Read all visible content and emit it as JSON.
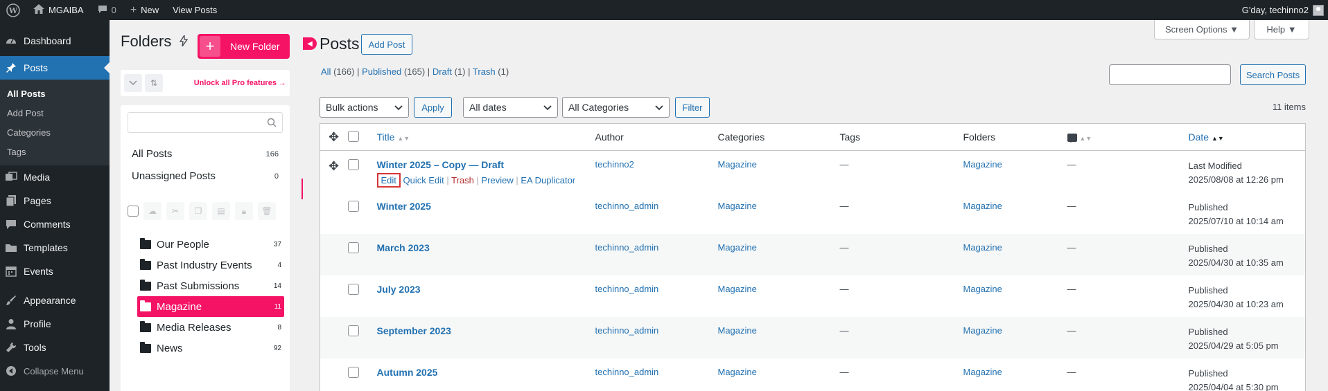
{
  "admin_bar": {
    "site_name": "MGAIBA",
    "comments_count": "0",
    "new_label": "New",
    "view_posts_label": "View Posts",
    "greeting": "G'day, techinno2"
  },
  "menu": {
    "items": [
      {
        "label": "Dashboard",
        "icon": "dashboard-icon"
      },
      {
        "label": "Posts",
        "icon": "pin-icon"
      },
      {
        "label": "Media",
        "icon": "media-icon"
      },
      {
        "label": "Pages",
        "icon": "pages-icon"
      },
      {
        "label": "Comments",
        "icon": "comments-icon"
      },
      {
        "label": "Templates",
        "icon": "templates-icon"
      },
      {
        "label": "Events",
        "icon": "calendar-icon"
      },
      {
        "label": "Appearance",
        "icon": "brush-icon"
      },
      {
        "label": "Profile",
        "icon": "user-icon"
      },
      {
        "label": "Tools",
        "icon": "wrench-icon"
      }
    ],
    "posts_submenu": [
      "All Posts",
      "Add Post",
      "Categories",
      "Tags"
    ],
    "collapse_label": "Collapse Menu"
  },
  "folders": {
    "title": "Folders",
    "new_folder_label": "New Folder",
    "unlock_label": "Unlock all Pro features →",
    "all_posts_label": "All Posts",
    "all_posts_count": "166",
    "unassigned_label": "Unassigned Posts",
    "unassigned_count": "0",
    "tree": [
      {
        "name": "Our People",
        "count": "37"
      },
      {
        "name": "Past Industry Events",
        "count": "4"
      },
      {
        "name": "Past Submissions",
        "count": "14"
      },
      {
        "name": "Magazine",
        "count": "11"
      },
      {
        "name": "Media Releases",
        "count": "8"
      },
      {
        "name": "News",
        "count": "92"
      }
    ]
  },
  "page": {
    "title": "Posts",
    "add_post_label": "Add Post",
    "screen_options_label": "Screen Options ▼",
    "help_label": "Help ▼",
    "filters": {
      "all": "All",
      "all_count": "(166)",
      "published": "Published",
      "published_count": "(165)",
      "draft": "Draft",
      "draft_count": "(1)",
      "trash": "Trash",
      "trash_count": "(1)"
    },
    "search_button_label": "Search Posts",
    "bulk_actions": "Bulk actions",
    "apply_label": "Apply",
    "all_dates": "All dates",
    "all_categories": "All Categories",
    "filter_label": "Filter",
    "items_count": "11 items"
  },
  "table": {
    "columns": {
      "title": "Title",
      "author": "Author",
      "categories": "Categories",
      "tags": "Tags",
      "folders": "Folders",
      "date": "Date"
    },
    "row_actions": {
      "edit": "Edit",
      "quick_edit": "Quick Edit",
      "trash": "Trash",
      "preview": "Preview",
      "duplicator": "EA Duplicator"
    },
    "rows": [
      {
        "title": "Winter 2025 – Copy — Draft",
        "author": "techinno2",
        "category": "Magazine",
        "tags": "—",
        "folder": "Magazine",
        "comments": "—",
        "status": "Last Modified",
        "date": "2025/08/08 at 12:26 pm"
      },
      {
        "title": "Winter 2025",
        "author": "techinno_admin",
        "category": "Magazine",
        "tags": "—",
        "folder": "Magazine",
        "comments": "—",
        "status": "Published",
        "date": "2025/07/10 at 10:14 am"
      },
      {
        "title": "March 2023",
        "author": "techinno_admin",
        "category": "Magazine",
        "tags": "—",
        "folder": "Magazine",
        "comments": "—",
        "status": "Published",
        "date": "2025/04/30 at 10:35 am"
      },
      {
        "title": "July 2023",
        "author": "techinno_admin",
        "category": "Magazine",
        "tags": "—",
        "folder": "Magazine",
        "comments": "—",
        "status": "Published",
        "date": "2025/04/30 at 10:23 am"
      },
      {
        "title": "September 2023",
        "author": "techinno_admin",
        "category": "Magazine",
        "tags": "—",
        "folder": "Magazine",
        "comments": "—",
        "status": "Published",
        "date": "2025/04/29 at 5:05 pm"
      },
      {
        "title": "Autumn 2025",
        "author": "techinno_admin",
        "category": "Magazine",
        "tags": "—",
        "folder": "Magazine",
        "comments": "—",
        "status": "Published",
        "date": "2025/04/04 at 5:30 pm"
      }
    ]
  },
  "colors": {
    "accent": "#2271b1",
    "folders_brand": "#f51366",
    "admin_dark": "#1d2327"
  }
}
